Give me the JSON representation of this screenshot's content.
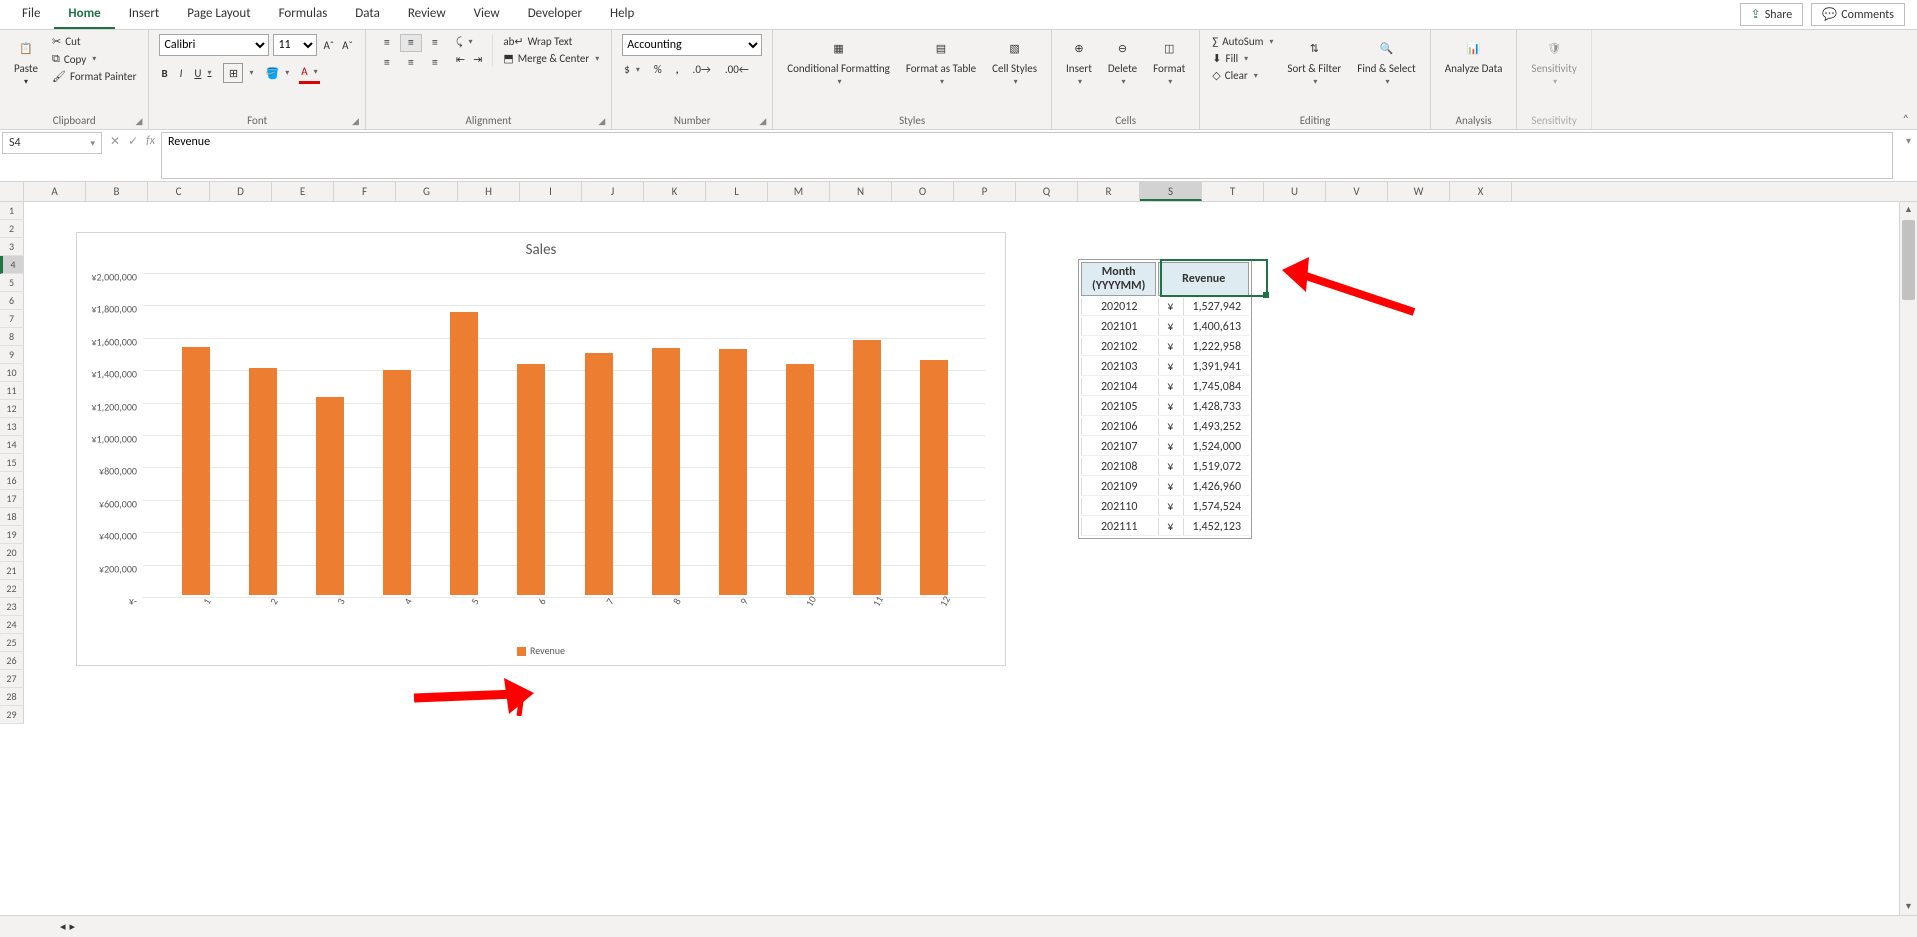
{
  "tabs": {
    "items": [
      "File",
      "Home",
      "Insert",
      "Page Layout",
      "Formulas",
      "Data",
      "Review",
      "View",
      "Developer",
      "Help"
    ],
    "active": "Home",
    "share": "Share",
    "comments": "Comments"
  },
  "ribbon": {
    "clipboard": {
      "title": "Clipboard",
      "paste": "Paste",
      "cut": "Cut",
      "copy": "Copy",
      "fp": "Format Painter"
    },
    "font": {
      "title": "Font",
      "name": "Calibri",
      "size": "11",
      "bold": "B",
      "italic": "I",
      "underline": "U"
    },
    "alignment": {
      "title": "Alignment",
      "wrap": "Wrap Text",
      "merge": "Merge & Center"
    },
    "number": {
      "title": "Number",
      "format": "Accounting",
      "sym": "$",
      "pct": "%",
      "comma": ",",
      "inc": ".0",
      "dec": ".00"
    },
    "styles": {
      "title": "Styles",
      "cf": "Conditional Formatting",
      "ft": "Format as Table",
      "cs": "Cell Styles"
    },
    "cells": {
      "title": "Cells",
      "ins": "Insert",
      "del": "Delete",
      "fmt": "Format"
    },
    "editing": {
      "title": "Editing",
      "autosum": "AutoSum",
      "fill": "Fill",
      "clear": "Clear",
      "sort": "Sort & Filter",
      "find": "Find & Select"
    },
    "analysis": {
      "title": "Analysis",
      "btn": "Analyze Data"
    },
    "sensitivity": {
      "title": "Sensitivity",
      "btn": "Sensitivity"
    }
  },
  "formula_bar": {
    "name_box": "S4",
    "formula": "Revenue"
  },
  "columns": [
    "A",
    "B",
    "C",
    "D",
    "E",
    "F",
    "G",
    "H",
    "I",
    "J",
    "K",
    "L",
    "M",
    "N",
    "O",
    "P",
    "Q",
    "R",
    "S",
    "T",
    "U",
    "V",
    "W",
    "X"
  ],
  "rows": 29,
  "selected_col_index": 18,
  "selected_row_index": 3,
  "chart_data": {
    "type": "bar",
    "title": "Sales",
    "categories": [
      "1",
      "2",
      "3",
      "4",
      "5",
      "6",
      "7",
      "8",
      "9",
      "10",
      "11",
      "12"
    ],
    "series": [
      {
        "name": "Revenue",
        "values": [
          1527942,
          1400613,
          1222958,
          1391941,
          1745084,
          1428733,
          1493252,
          1524000,
          1519072,
          1426960,
          1574524,
          1452123
        ]
      }
    ],
    "ylim": [
      0,
      2000000
    ],
    "yticks": [
      "¥-",
      "¥200,000",
      "¥400,000",
      "¥600,000",
      "¥800,000",
      "¥1,000,000",
      "¥1,200,000",
      "¥1,400,000",
      "¥1,600,000",
      "¥1,800,000",
      "¥2,000,000"
    ],
    "legend": "Revenue"
  },
  "table": {
    "headers": {
      "month": "Month (YYYYMM)",
      "revenue": "Revenue"
    },
    "currency": "¥",
    "rows": [
      {
        "m": "202012",
        "v": "1,527,942"
      },
      {
        "m": "202101",
        "v": "1,400,613"
      },
      {
        "m": "202102",
        "v": "1,222,958"
      },
      {
        "m": "202103",
        "v": "1,391,941"
      },
      {
        "m": "202104",
        "v": "1,745,084"
      },
      {
        "m": "202105",
        "v": "1,428,733"
      },
      {
        "m": "202106",
        "v": "1,493,252"
      },
      {
        "m": "202107",
        "v": "1,524,000"
      },
      {
        "m": "202108",
        "v": "1,519,072"
      },
      {
        "m": "202109",
        "v": "1,426,960"
      },
      {
        "m": "202110",
        "v": "1,574,524"
      },
      {
        "m": "202111",
        "v": "1,452,123"
      }
    ]
  }
}
